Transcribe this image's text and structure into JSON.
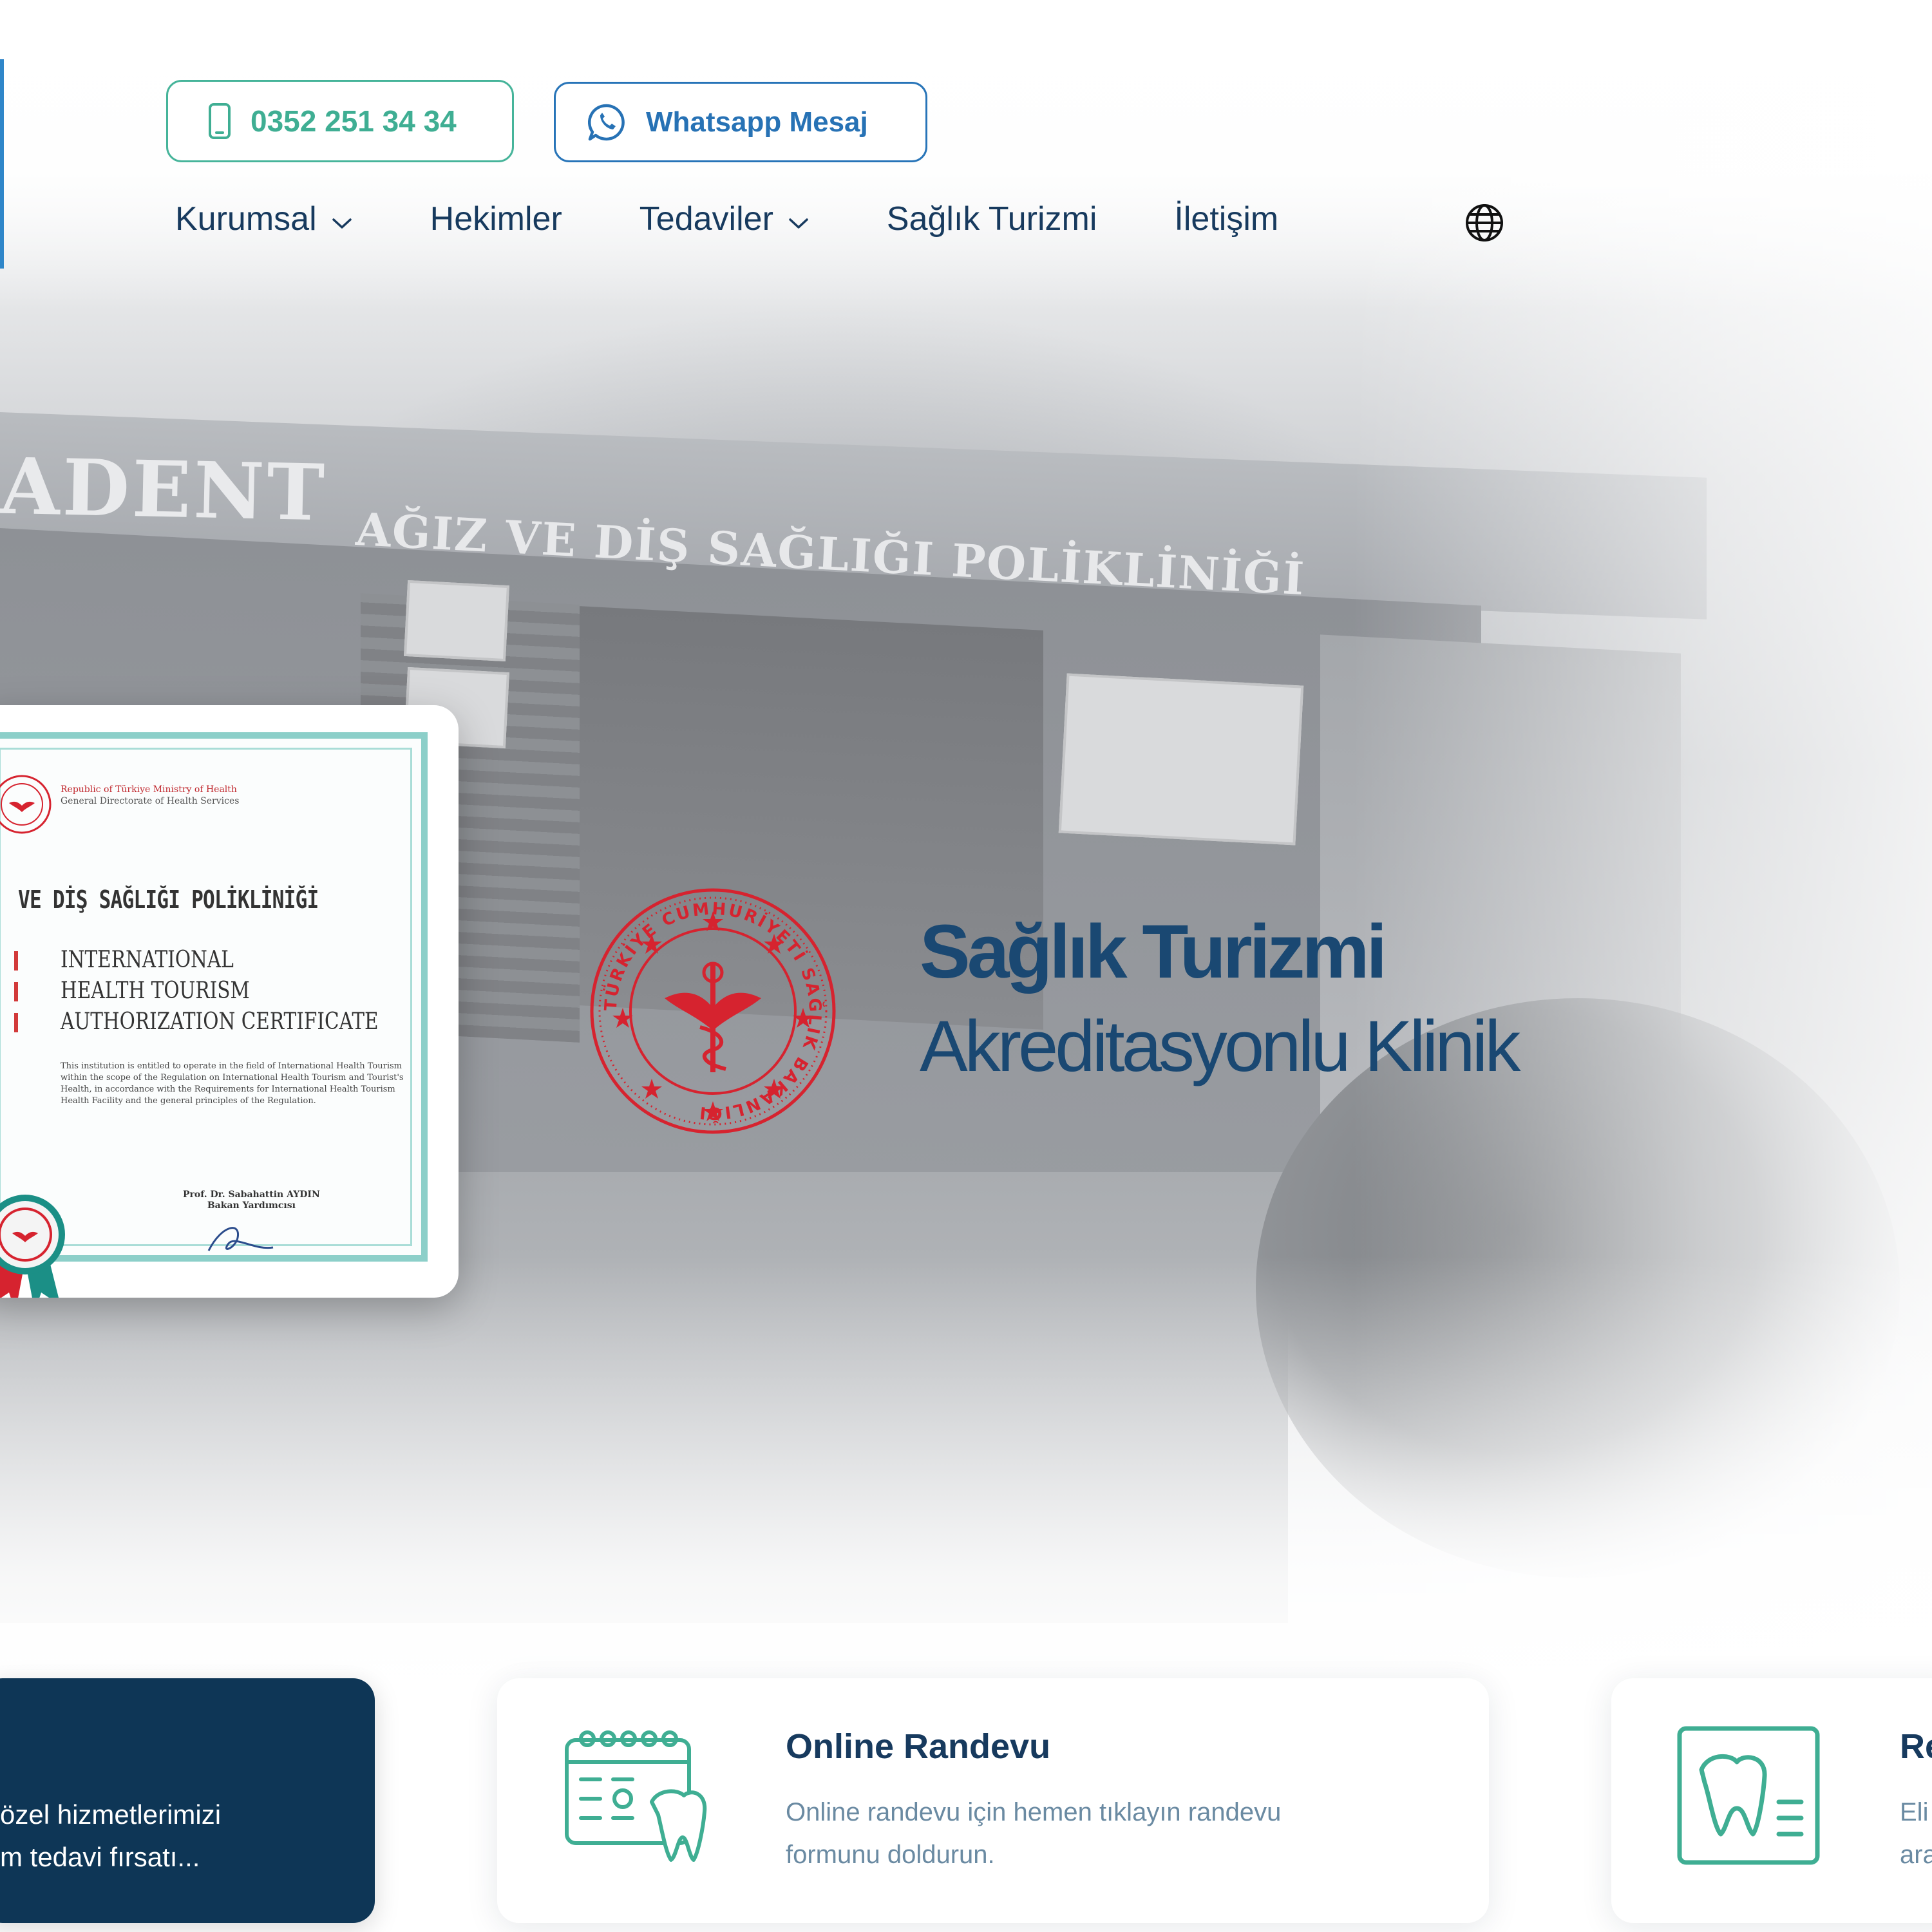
{
  "header": {
    "phone_label": "0352 251 34 34",
    "whatsapp_label": "Whatsapp Mesaj",
    "nav": [
      {
        "label": "Kurumsal",
        "has_dropdown": true
      },
      {
        "label": "Hekimler",
        "has_dropdown": false
      },
      {
        "label": "Tedaviler",
        "has_dropdown": true
      },
      {
        "label": "Sağlık Turizmi",
        "has_dropdown": false
      },
      {
        "label": "İletişim",
        "has_dropdown": false
      }
    ],
    "language_icon": "globe-icon"
  },
  "hero": {
    "building_sign_left": "ADENT",
    "building_sign": "AĞIZ VE DİŞ SAĞLIĞI POLİKLİNİĞİ",
    "certificate": {
      "ministry_line1": "Republic of Türkiye Ministry of Health",
      "ministry_line2": "General Directorate of Health Services",
      "clinic_name": "VE DİŞ SAĞLIĞI POLİKLİNİĞİ",
      "heading_line1": "INTERNATIONAL",
      "heading_line2": "HEALTH TOURISM",
      "heading_line3": "AUTHORIZATION CERTIFICATE",
      "body": "This institution is entitled to operate in the field of International Health Tourism within the scope of the Regulation on International Health Tourism and Tourist's Health, in accordance with the Requirements for International Health Tourism Health Facility and the general principles of the Regulation.",
      "signer_name": "Prof. Dr. Sabahattin AYDIN",
      "signer_title": "Bakan Yardımcısı"
    },
    "seal_text": "TÜRKİYE CUMHURİYETİ SAĞLIK BAKANLIĞI",
    "title": "Sağlık Turizmi",
    "subtitle": "Akreditasyonlu Klinik"
  },
  "cards": {
    "dark": {
      "line1": "özel hizmetlerimizi",
      "line2": "m tedavi fırsatı..."
    },
    "online": {
      "title": "Online Randevu",
      "desc_line1": "Online randevu için hemen tıklayın randevu",
      "desc_line2": "formunu doldurun.",
      "icon": "calendar-tooth-icon"
    },
    "third": {
      "title": "Re",
      "desc_line1": "Eli",
      "desc_line2": "ara",
      "icon": "tooth-report-icon"
    }
  },
  "colors": {
    "navy": "#173a5e",
    "green": "#3fae93",
    "blue": "#2772b5",
    "dark_card": "#0e3656",
    "seal_red": "#d6232f"
  }
}
